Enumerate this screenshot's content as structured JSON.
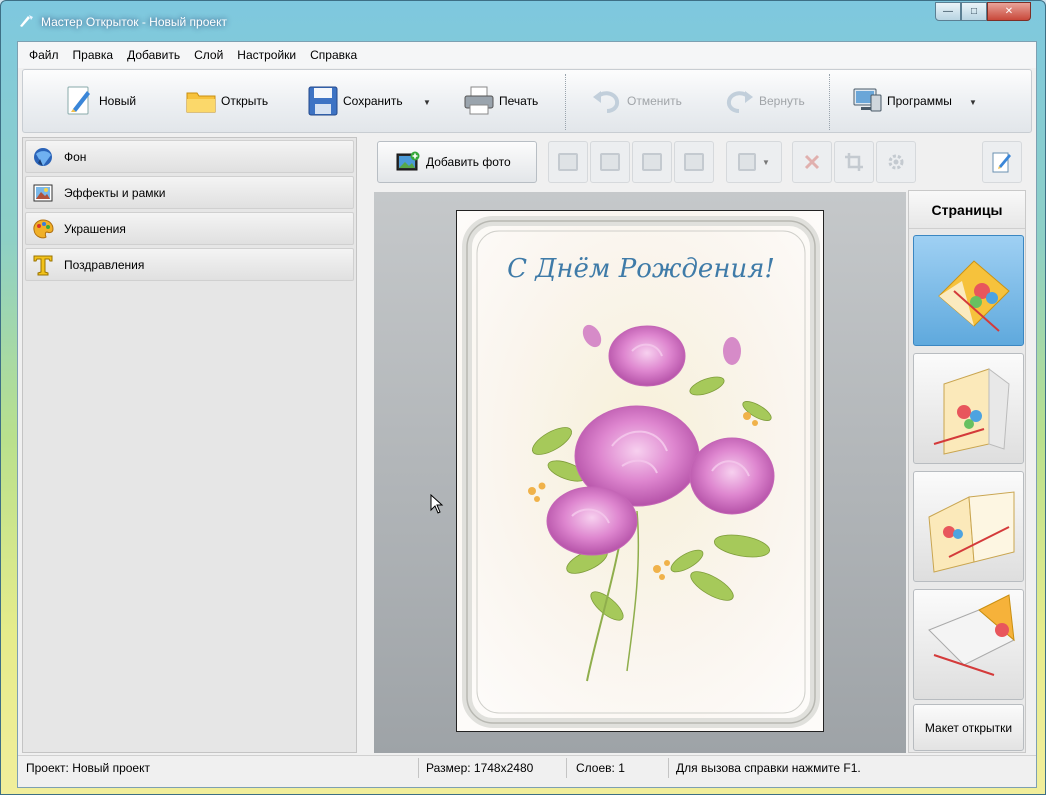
{
  "window": {
    "title": "Мастер Открыток - Новый проект",
    "controls": {
      "minimize": "—",
      "maximize": "□",
      "close": "✕"
    }
  },
  "menu": [
    "Файл",
    "Правка",
    "Добавить",
    "Слой",
    "Настройки",
    "Справка"
  ],
  "toolbar": {
    "new_label": "Новый",
    "open_label": "Открыть",
    "save_label": "Сохранить",
    "print_label": "Печать",
    "undo_label": "Отменить",
    "redo_label": "Вернуть",
    "programs_label": "Программы"
  },
  "left_panel": {
    "items": [
      {
        "label": "Фон",
        "icon": "background-icon"
      },
      {
        "label": "Эффекты и рамки",
        "icon": "frame-effects-icon"
      },
      {
        "label": "Украшения",
        "icon": "palette-icon"
      },
      {
        "label": "Поздравления",
        "icon": "text-t-icon"
      }
    ]
  },
  "editor_toolbar": {
    "add_photo_label": "Добавить фото"
  },
  "card": {
    "greeting": "С Днём Рождения!"
  },
  "pages": {
    "title": "Страницы",
    "layout_button": "Макет открытки"
  },
  "status": {
    "project": "Проект: Новый проект",
    "size": "Размер: 1748x2480",
    "layers": "Слоев: 1",
    "help": "Для вызова справки нажмите F1."
  },
  "colors": {
    "accent": "#5fa9dd",
    "greeting": "#3f7ba8",
    "rose": "#d77fc8"
  }
}
